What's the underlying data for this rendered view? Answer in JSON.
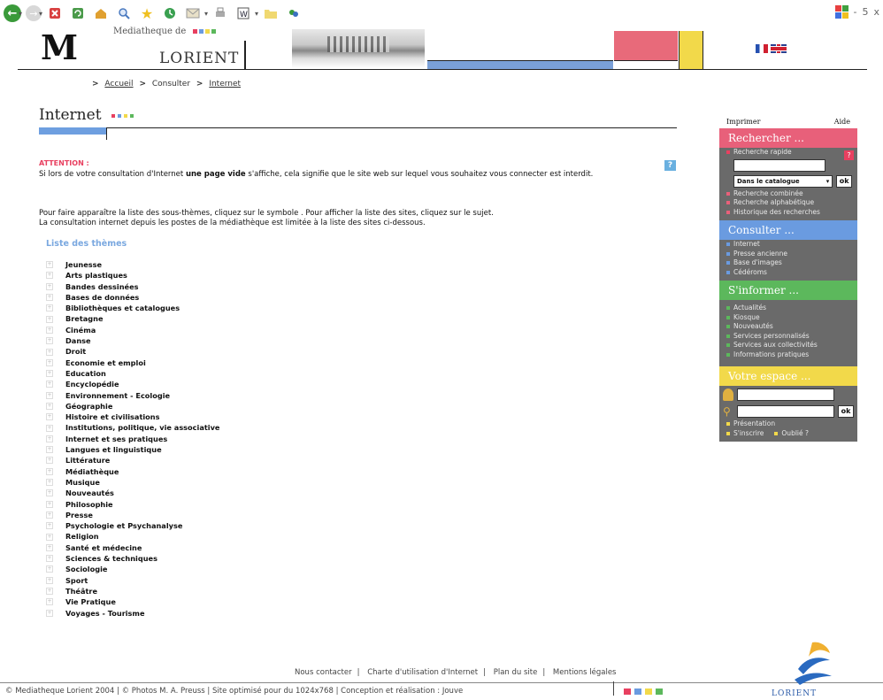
{
  "toolbar": {
    "win_controls": [
      "-",
      "5",
      "x"
    ]
  },
  "header": {
    "brand_top": "Mediatheque de",
    "brand_main": "LORIENT",
    "logo_letter": "M",
    "brand_dot_colors": [
      "#e84060",
      "#6a9be0",
      "#f2d94a",
      "#5cb85c"
    ]
  },
  "breadcrumb": {
    "home": "Accueil",
    "consult": "Consulter",
    "current": "Internet",
    "separator": ">"
  },
  "page": {
    "title": "Internet",
    "attention_label": "ATTENTION :",
    "attention_text_before": "Si lors de votre consultation d'Internet ",
    "attention_text_bold": "une page vide",
    "attention_text_after": " s'affiche, cela signifie que le site web sur lequel vous souhaitez vous connecter est interdit.",
    "help_label": "?",
    "instructions_1": "Pour faire apparaître la liste des sous-thèmes, cliquez sur le symbole   . Pour afficher la liste des sites, cliquez sur le sujet.",
    "instructions_2": "La consultation internet depuis les postes de la médiathèque est limitée à la liste des sites ci-dessous.",
    "themes_title": "Liste des thèmes",
    "themes": [
      "Jeunesse",
      "Arts plastiques",
      "Bandes dessinées",
      "Bases de données",
      "Bibliothèques et catalogues",
      "Bretagne",
      "Cinéma",
      "Danse",
      "Droit",
      "Economie et emploi",
      "Education",
      "Encyclopédie",
      "Environnement - Ecologie",
      "Géographie",
      "Histoire et civilisations",
      "Institutions, politique, vie associative",
      "Internet et ses pratiques",
      "Langues et linguistique",
      "Littérature",
      "Médiathèque",
      "Musique",
      "Nouveautés",
      "Philosophie",
      "Presse",
      "Psychologie et Psychanalyse",
      "Religion",
      "Santé et médecine",
      "Sciences & techniques",
      "Sociologie",
      "Sport",
      "Théâtre",
      "Vie Pratique",
      "Voyages - Tourisme"
    ]
  },
  "sidebar": {
    "print": "Imprimer",
    "help": "Aide",
    "search": {
      "heading": "Rechercher ...",
      "color": "#e8607a",
      "quick": "Recherche rapide",
      "scope": "Dans le catalogue",
      "ok": "ok",
      "help": "?",
      "links": [
        "Recherche combinée",
        "Recherche alphabétique",
        "Historique des recherches"
      ]
    },
    "consult": {
      "heading": "Consulter ...",
      "color": "#6a9be0",
      "links": [
        "Internet",
        "Presse ancienne",
        "Base d'images",
        "Cédéroms"
      ]
    },
    "inform": {
      "heading": "S'informer ...",
      "color": "#5cb85c",
      "links": [
        "Actualités",
        "Kiosque",
        "Nouveautés",
        "Services personnalisés",
        "Services aux collectivités",
        "Informations pratiques"
      ]
    },
    "space": {
      "heading": "Votre espace ...",
      "color": "#f2d94a",
      "ok": "ok",
      "presentation": "Présentation",
      "register": "S'inscrire",
      "forgot": "Oublié ?"
    }
  },
  "footer": {
    "contact": "Nous contacter",
    "charter": "Charte d'utilisation d'Internet",
    "sitemap": "Plan du site",
    "legal": "Mentions légales",
    "copyright": "© Mediatheque Lorient 2004 | © Photos M. A. Preuss | Site optimisé pour du 1024x768 | Conception et réalisation : Jouve",
    "logo_text": "LORIENT"
  }
}
